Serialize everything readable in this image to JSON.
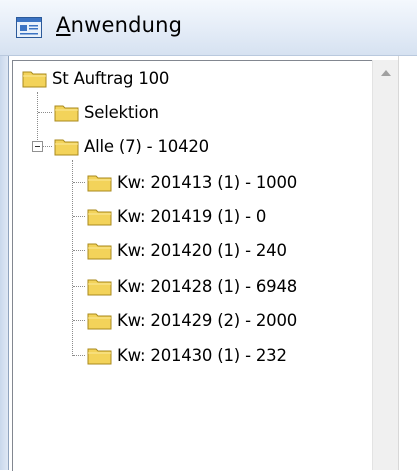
{
  "header": {
    "title_first": "A",
    "title_rest": "nwendung"
  },
  "tree": {
    "root": {
      "label": "St Auftrag 100"
    },
    "selektion": {
      "label": "Selektion"
    },
    "alle": {
      "label": "Alle (7) - 10420",
      "expanded": true
    },
    "children": [
      {
        "label": "Kw: 201413 (1) - 1000"
      },
      {
        "label": "Kw: 201419 (1) - 0"
      },
      {
        "label": "Kw: 201420 (1) - 240"
      },
      {
        "label": "Kw: 201428 (1) - 6948"
      },
      {
        "label": "Kw: 201429 (2) - 2000"
      },
      {
        "label": "Kw: 201430 (1) - 232"
      }
    ]
  },
  "icons": {
    "app": "application-window-icon",
    "folder": "folder-icon",
    "expander": "collapse-minus-icon",
    "scroll": "scroll-up-arrow-icon"
  },
  "colors": {
    "folder_fill": "#f3d35a",
    "folder_edge": "#a98a1c",
    "header_bg": "#e4ecf7"
  }
}
